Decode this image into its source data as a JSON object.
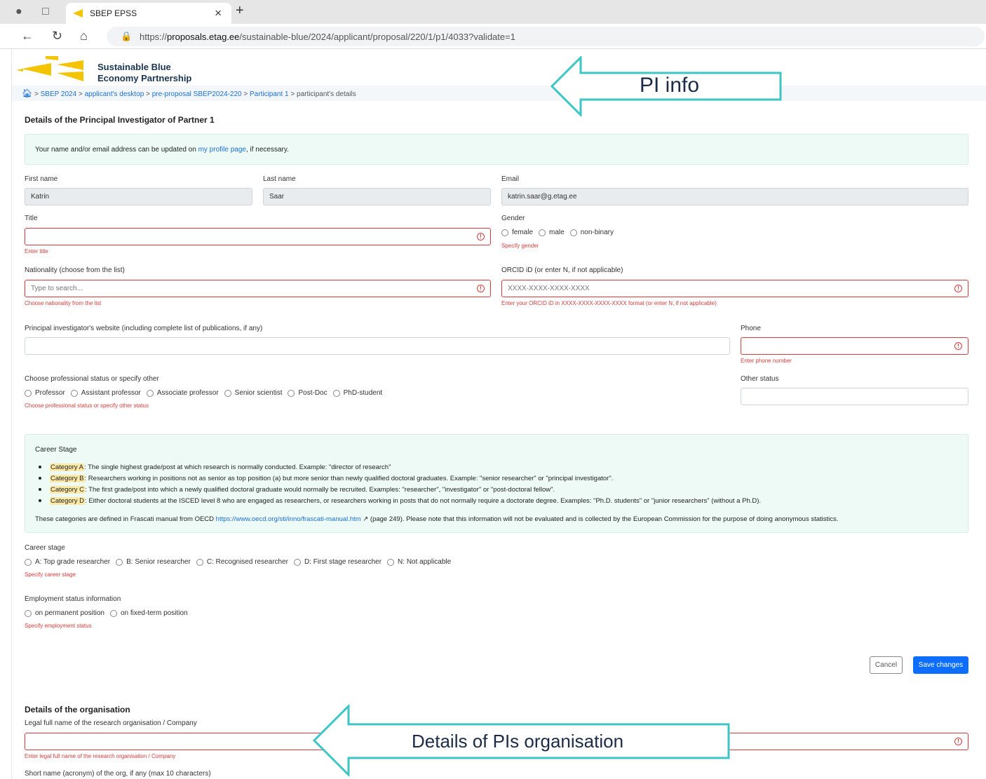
{
  "browser": {
    "tab_title": "SBEP EPSS",
    "close_tab": "×",
    "new_tab": "+",
    "url_prefix": "https://",
    "url_domain": "proposals.etag.ee",
    "url_path": "/sustainable-blue/2024/applicant/proposal/220/1/p1/4033?validate=1"
  },
  "logo": {
    "line1": "Sustainable Blue",
    "line2": "Economy Partnership",
    "color": "#f5c400"
  },
  "breadcrumb": {
    "sep": ">",
    "items": [
      "SBEP 2024",
      "applicant's desktop",
      "pre-proposal SBEP2024-220",
      "Participant 1"
    ],
    "current": "participant's details"
  },
  "pi": {
    "heading": "Details of the Principal Investigator of Partner 1",
    "info_pre": "Your name and/or email address can be updated on ",
    "info_link": "my profile page",
    "info_post": ", if necessary.",
    "first_name_label": "First name",
    "first_name": "Katrin",
    "last_name_label": "Last name",
    "last_name": "Saar",
    "email_label": "Email",
    "email": "katrin.saar@g.etag.ee",
    "title_label": "Title",
    "title_error": "Enter title",
    "gender_label": "Gender",
    "gender_options": [
      "female",
      "male",
      "non-binary"
    ],
    "gender_error": "Specify gender",
    "nationality_label": "Nationality (choose from the list)",
    "nationality_placeholder": "Type to search...",
    "nationality_error": "Choose nationality from the list",
    "orcid_label": "ORCID iD (or enter N, if not applicable)",
    "orcid_placeholder": "XXXX-XXXX-XXXX-XXXX",
    "orcid_error": "Enter your ORCID iD in XXXX-XXXX-XXXX-XXXX format (or enter N, if not applicable)",
    "website_label": "Principal investigator's website (including complete list of publications, if any)",
    "phone_label": "Phone",
    "phone_error": "Enter phone number",
    "status_label": "Choose professional status or specify other",
    "status_options": [
      "Professor",
      "Assistant professor",
      "Associate professor",
      "Senior scientist",
      "Post-Doc",
      "PhD-student"
    ],
    "status_error": "Choose professional status or specify other status",
    "other_status_label": "Other status"
  },
  "career_info": {
    "title": "Career Stage",
    "items": [
      {
        "cat": "Category A",
        "text": ": The single highest grade/post at which research is normally conducted. Example: \"director of research\""
      },
      {
        "cat": "Category B",
        "text": ": Researchers working in positions not as senior as top position (a) but more senior than newly qualified doctoral graduates. Example: \"senior researcher\" or \"principal investigator\"."
      },
      {
        "cat": "Category C",
        "text": ": The first grade/post into which a newly qualified doctoral graduate would normally be recruited. Examples: \"researcher\", \"investigator\" or \"post-doctoral fellow\"."
      },
      {
        "cat": "Category D",
        "text": ": Either doctoral students at the ISCED level 8 who are engaged as researchers, or researchers working in posts that do not normally require a doctorate degree. Examples: \"Ph.D. students\" or \"junior researchers\" (without a Ph.D)."
      }
    ],
    "note_pre": "These categories are defined in Frascati manual from OECD ",
    "note_link": "https://www.oecd.org/sti/inno/frascati-manual.htm",
    "note_post": " (page 249). Please note that this information will not be evaluated and is collected by the European Commission for the purpose of doing anonymous statistics."
  },
  "career_stage": {
    "label": "Career stage",
    "options": [
      "A: Top grade researcher",
      "B: Senior researcher",
      "C: Recognised researcher",
      "D: First stage researcher",
      "N: Not applicable"
    ],
    "error": "Specify career stage"
  },
  "employment": {
    "label": "Employment status information",
    "options": [
      "on permanent position",
      "on fixed-term position"
    ],
    "error": "Specify employment status"
  },
  "actions": {
    "cancel": "Cancel",
    "save": "Save changes"
  },
  "org": {
    "heading": "Details of the organisation",
    "legal_label": "Legal full name of the research organisation / Company",
    "legal_error": "Enter legal full name of the research organisation / Company",
    "short_label": "Short name (acronym) of the org, if any (max 10 characters)"
  },
  "callouts": {
    "pi": "PI info",
    "org": "Details of PIs organisation",
    "color": "#3cc6c6"
  }
}
